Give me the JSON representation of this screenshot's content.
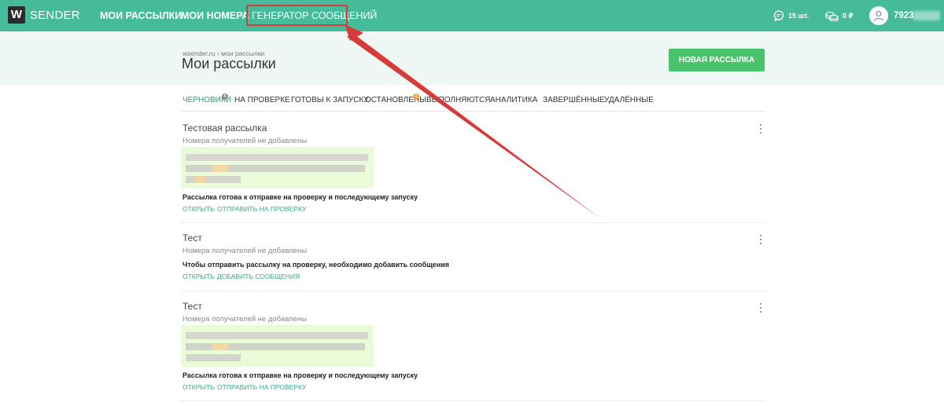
{
  "brand": {
    "logo_letter": "W",
    "name": "SENDER"
  },
  "nav": {
    "my_mailings": "Мои рассылки",
    "my_numbers": "Мои номера",
    "generator": "Генератор сообщений"
  },
  "stats": {
    "messages": "15 шт.",
    "balance": "0 ₽"
  },
  "user": {
    "number": "7923"
  },
  "page": {
    "breadcrumb": "wsender.ru › мои рассылки",
    "title": "Мои рассылки",
    "new_button": "Новая рассылка"
  },
  "tabs": [
    {
      "label": "Черновики",
      "badge": "5"
    },
    {
      "label": "На проверке"
    },
    {
      "label": "Готовы к запуску"
    },
    {
      "label": "Остановлены",
      "badge": "1"
    },
    {
      "label": "Выполняются"
    },
    {
      "label": "Аналитика"
    },
    {
      "label": "Завершённые"
    },
    {
      "label": "Удалённые"
    }
  ],
  "items": [
    {
      "title": "Тестовая рассылка",
      "recipients": "Номера получателей не добавлены",
      "status": "Рассылка готова к отправке на проверку и последующему запуску",
      "actions": [
        "Открыть",
        "Отправить на проверку"
      ]
    },
    {
      "title": "Тест",
      "recipients": "Номера получателей не добавлены",
      "status": "Чтобы отправить рассылку на проверку, необходимо добавить сообщения",
      "actions": [
        "Открыть",
        "Добавить сообщения"
      ]
    },
    {
      "title": "Тест",
      "recipients": "Номера получателей не добавлены",
      "status": "Рассылка готова к отправке на проверку и последующему запуску",
      "actions": [
        "Открыть",
        "Отправить на проверку"
      ]
    }
  ],
  "colors": {
    "topbar": "#46bb9a",
    "subheader": "#eef7f4",
    "button": "#49c46c",
    "active_tab": "#2e9c7a",
    "link": "#3aa88a",
    "annotation": "#d63a3a"
  },
  "icons": {
    "messages": "chat-bubble-icon",
    "balance": "coins-icon",
    "avatar": "user-icon",
    "menu": "kebab-menu-icon"
  }
}
